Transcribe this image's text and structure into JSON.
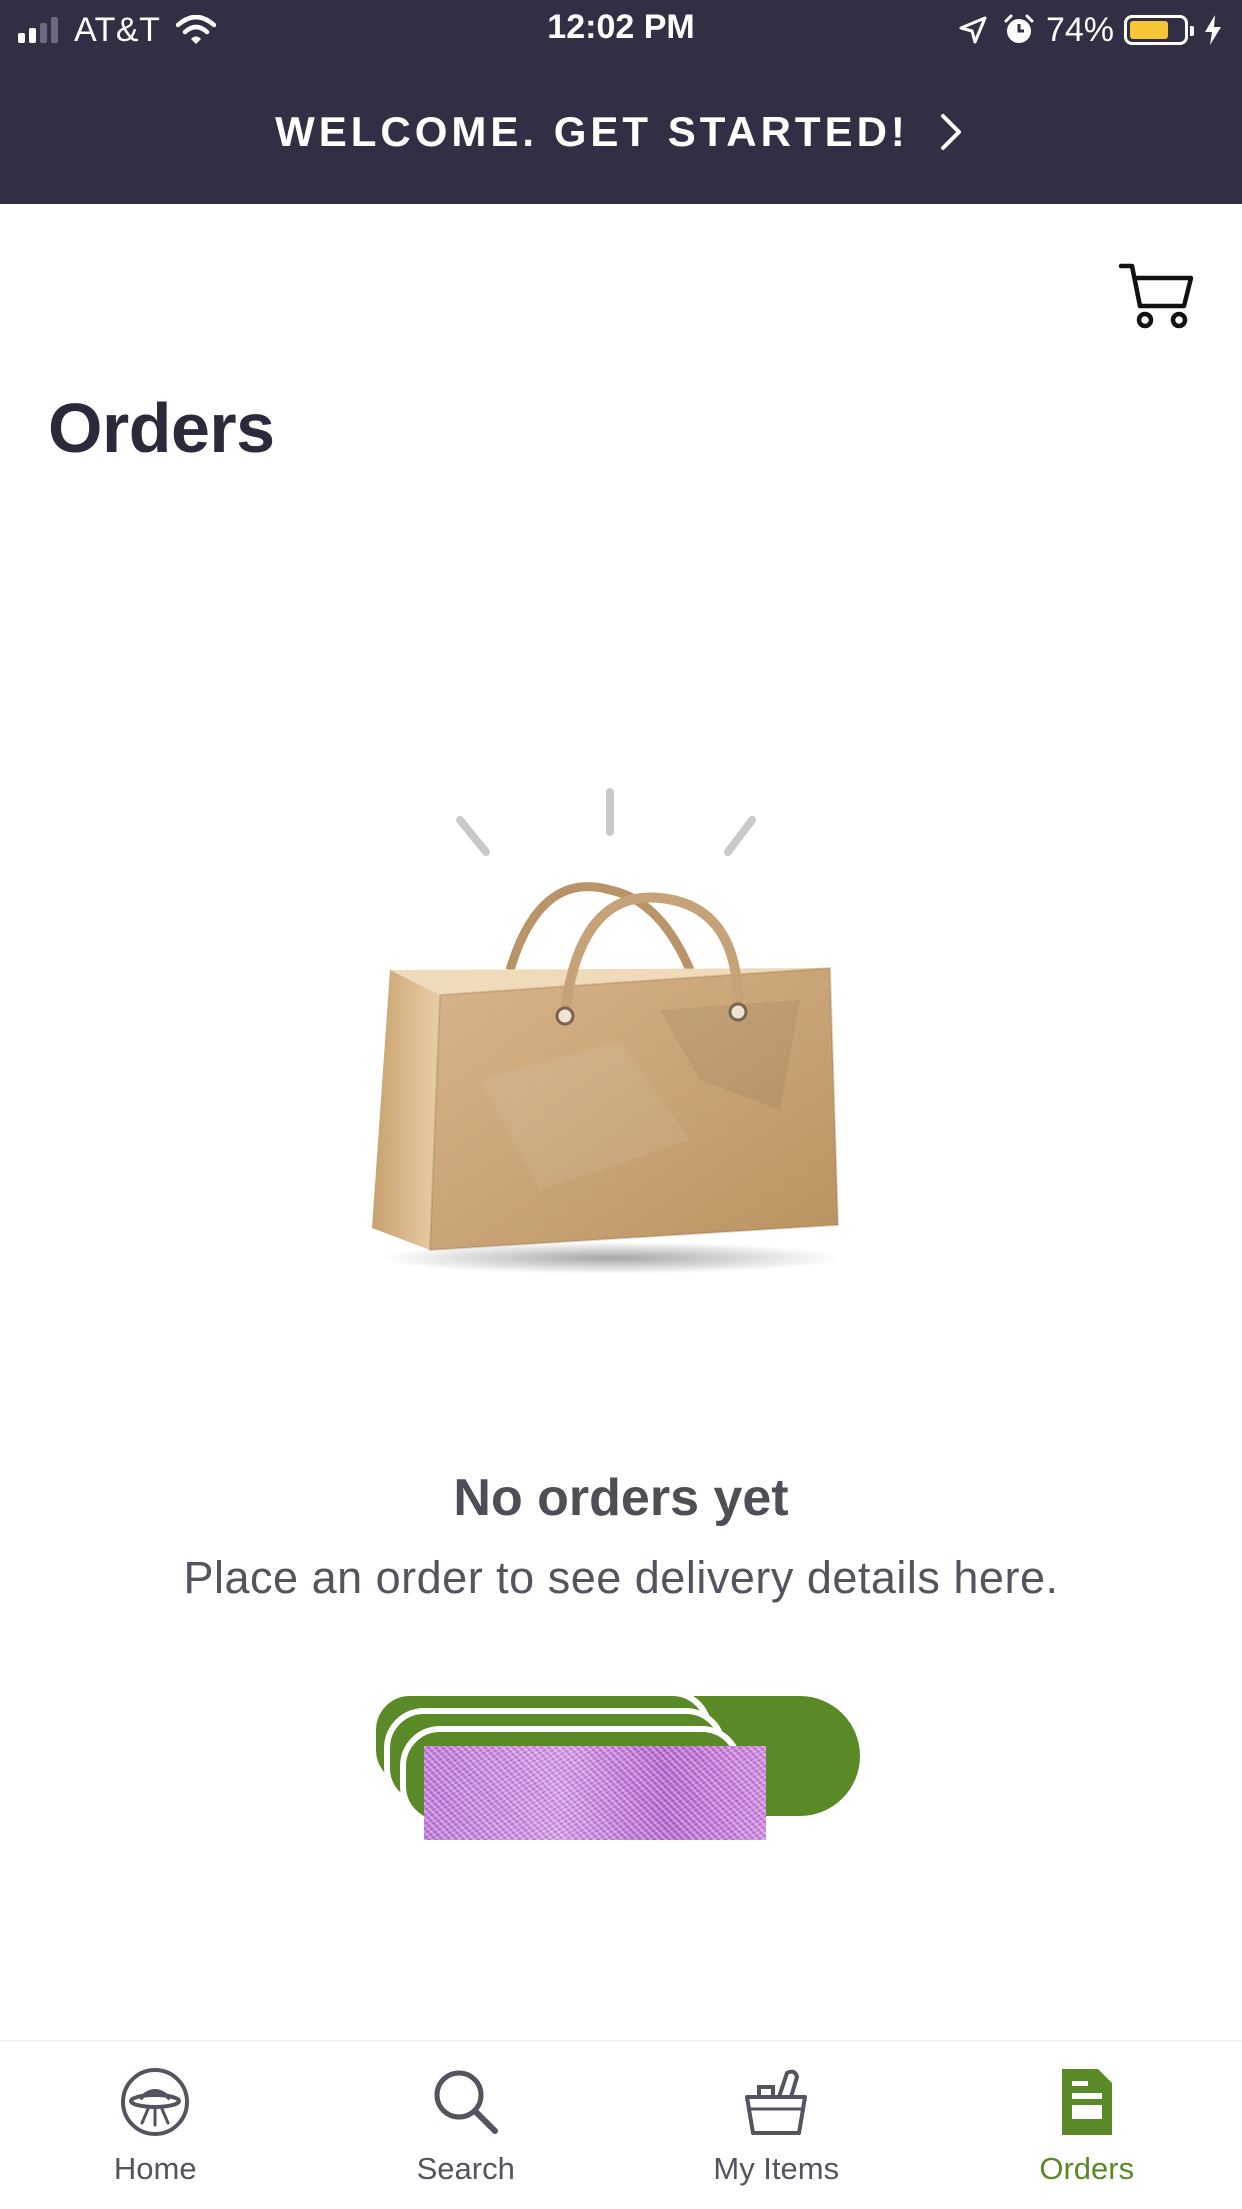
{
  "status_bar": {
    "carrier": "AT&T",
    "time": "12:02 PM",
    "battery_percent": "74%",
    "battery_level": 0.74,
    "battery_color": "#f6c636",
    "icons": [
      "signal-icon",
      "wifi-icon",
      "location-icon",
      "alarm-icon",
      "battery-icon",
      "charging-icon"
    ]
  },
  "banner": {
    "text": "WELCOME. GET STARTED!",
    "icon": "chevron-right-icon",
    "background": "#322f44"
  },
  "header": {
    "cart_icon": "cart-icon"
  },
  "page": {
    "title": "Orders"
  },
  "empty_state": {
    "illustration": "shopping-bag-icon",
    "heading": "No orders yet",
    "subtext": "Place an order to see delivery details here.",
    "button_color": "#5a8a27"
  },
  "tab_bar": {
    "active_color": "#5a8a27",
    "tabs": [
      {
        "label": "Home",
        "icon": "ufo-icon",
        "active": false
      },
      {
        "label": "Search",
        "icon": "search-icon",
        "active": false
      },
      {
        "label": "My Items",
        "icon": "grocery-basket-icon",
        "active": false
      },
      {
        "label": "Orders",
        "icon": "orders-document-icon",
        "active": true
      }
    ]
  }
}
